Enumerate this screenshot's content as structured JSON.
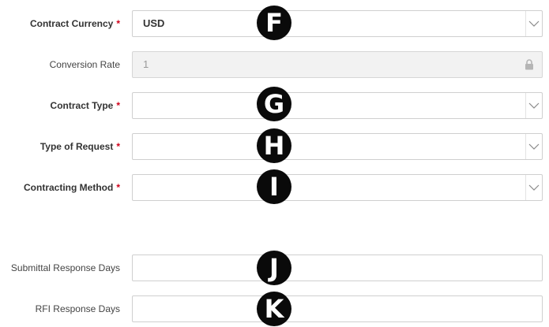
{
  "form": {
    "contract_currency": {
      "label": "Contract Currency",
      "required_mark": "*",
      "value": "USD"
    },
    "conversion_rate": {
      "label": "Conversion Rate",
      "value": "1"
    },
    "contract_type": {
      "label": "Contract Type",
      "required_mark": "*",
      "value": ""
    },
    "type_of_request": {
      "label": "Type of Request",
      "required_mark": "*",
      "value": ""
    },
    "contracting_method": {
      "label": "Contracting Method",
      "required_mark": "*",
      "value": ""
    },
    "submittal_response_days": {
      "label": "Submittal Response Days",
      "value": ""
    },
    "rfi_response_days": {
      "label": "RFI Response Days",
      "value": ""
    }
  },
  "markers": [
    "F",
    "G",
    "H",
    "I",
    "J",
    "K"
  ],
  "icons": {
    "dropdown": "chevron-down-icon",
    "locked": "lock-icon"
  },
  "colors": {
    "required": "#d0021b",
    "border": "#cfcfcf",
    "disabled_bg": "#f2f2f2",
    "marker_bg": "#0a0a0a"
  }
}
